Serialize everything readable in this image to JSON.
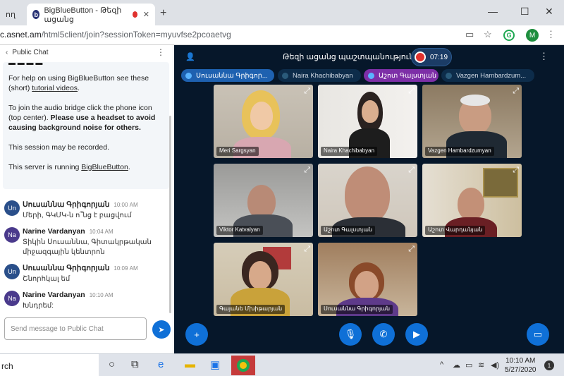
{
  "browser": {
    "tabs": [
      {
        "label": "ող"
      },
      {
        "label": "BigBlueButton - Թեզի ացանց"
      }
    ],
    "url_host": "c.asnet.am",
    "url_path": "/html5client/join?sessionToken=myuvfse2pcoaetvg",
    "new_tab": "+",
    "close_tab": "✕",
    "window": {
      "minimize": "—",
      "maximize": "☐",
      "close": "✕"
    },
    "profile_initial": "M",
    "ext_initial": "G"
  },
  "chat": {
    "title": "Public Chat",
    "welcome": {
      "p1_start": "For help on using BigBlueButton see these (short) ",
      "p1_link": "tutorial videos",
      "p1_end": ".",
      "p2_start": "To join the audio bridge click the phone icon (top center). ",
      "p2_bold": "Please use a headset to avoid causing background noise for others.",
      "p3": "This session may be recorded.",
      "p4_start": "This server is running ",
      "p4_link": "BigBlueButton",
      "p4_end": "."
    },
    "messages": [
      {
        "initials": "Un",
        "name": "Սուսաննա Գրիգորյան",
        "time": "10:00 AM",
        "text": "Մերի, ԳԿՄԿ-ն ո՞նց է բացվում"
      },
      {
        "initials": "Na",
        "name": "Narine Vardanyan",
        "time": "10:04 AM",
        "text": "Տիկին Սուսաննա, Գիտակրթական միջազգային կենտրոն"
      },
      {
        "initials": "Un",
        "name": "Սուսաննա Գրիգորյան",
        "time": "10:09 AM",
        "text": "Շնորհկալ եմ"
      },
      {
        "initials": "Na",
        "name": "Narine Vardanyan",
        "time": "10:10 AM",
        "text": "Խնդրեմ:"
      }
    ],
    "composer_placeholder": "Send message to Public Chat"
  },
  "meeting": {
    "title": "Թեզի ացանց պաշտպանություն",
    "rec_time": "07:19",
    "talkers": [
      {
        "name": "Սուսաննա Գրիգոր...",
        "style": "blue"
      },
      {
        "name": "Naira Khachibabyan",
        "style": "dark"
      },
      {
        "name": "Աշոտ Գալստյան",
        "style": "purple"
      },
      {
        "name": "Vazgen Hambardzum...",
        "style": "dark"
      }
    ],
    "tiles": [
      {
        "name": "Meri Sargsyan"
      },
      {
        "name": "Naira Khachibabyan"
      },
      {
        "name": "Vazgen Hambardzumyan"
      },
      {
        "name": "Viktor Katvalyan"
      },
      {
        "name": "Աշոտ Գալստյան"
      },
      {
        "name": "Աշոտ Վարդանյան"
      },
      {
        "name": "Գայանե Մխիթարյան"
      },
      {
        "name": "Սուսաննա Գրիգորյան"
      }
    ]
  },
  "taskbar": {
    "search": "rch",
    "time": "10:10 AM",
    "date": "5/27/2020",
    "notifications": "1"
  }
}
